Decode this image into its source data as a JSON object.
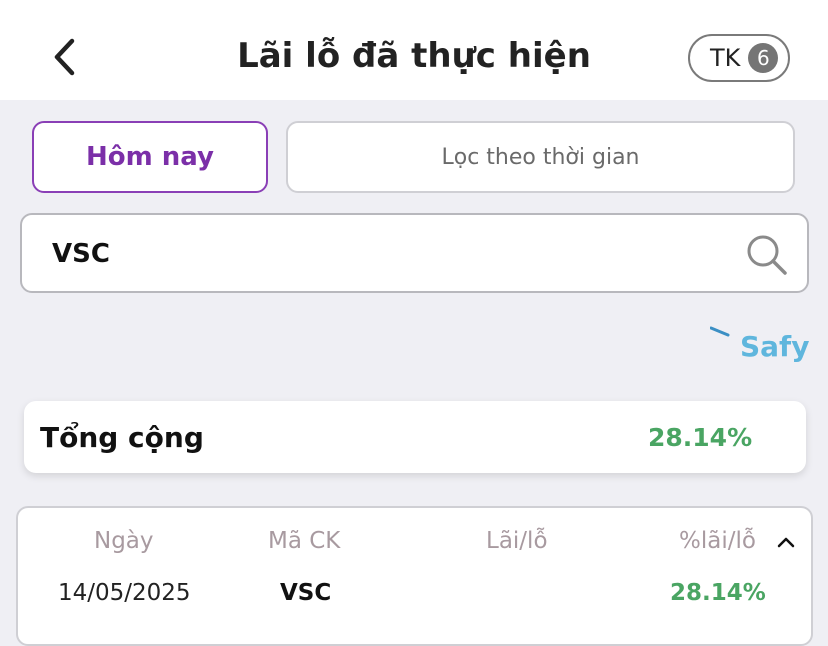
{
  "header": {
    "title": "Lãi lỗ đã thực hiện",
    "account_label": "TK",
    "account_count": "6"
  },
  "tabs": {
    "today_label": "Hôm nay",
    "filter_label": "Lọc theo thời gian"
  },
  "search": {
    "value": "VSC"
  },
  "brand": {
    "name": "Safy"
  },
  "summary": {
    "label": "Tổng cộng",
    "percent": "28.14%"
  },
  "table": {
    "columns": [
      "Ngày",
      "Mã CK",
      "Lãi/lỗ",
      "%lãi/lỗ"
    ],
    "rows": [
      {
        "date": "14/05/2025",
        "symbol": "VSC",
        "pnl": "",
        "pnl_percent": "28.14%"
      }
    ]
  },
  "colors": {
    "accent": "#7b2fa8",
    "positive": "#4aa563",
    "brand": "#5fb6dd"
  }
}
